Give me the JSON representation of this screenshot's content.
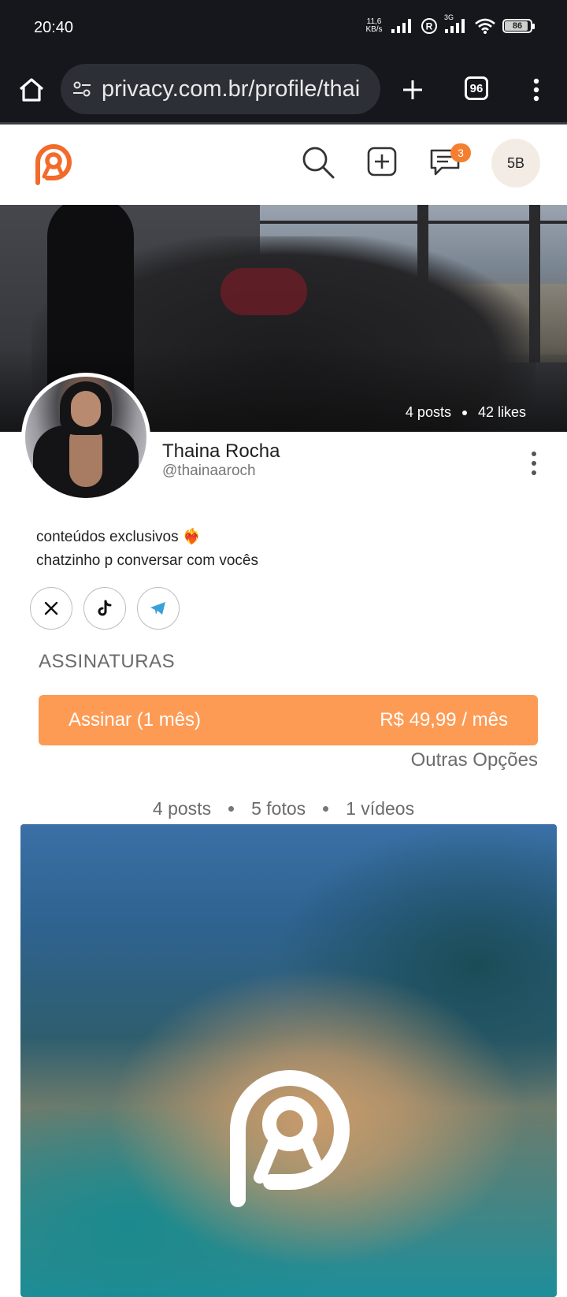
{
  "status_bar": {
    "time": "20:40",
    "net_speed_top": "11,6",
    "net_speed_bottom": "KB/s",
    "network_label": "3G",
    "battery": "86"
  },
  "browser": {
    "url": "privacy.com.br/profile/thai",
    "tab_count": "96"
  },
  "header": {
    "message_badge": "3",
    "avatar_initials": "5B",
    "brand_color": "#f26b2b"
  },
  "cover": {
    "posts": "4 posts",
    "likes": "42 likes"
  },
  "profile": {
    "name": "Thaina Rocha",
    "handle": "@thainaaroch",
    "bio_line1": "conteúdos exclusivos ❤️‍🔥",
    "bio_line2": "chatzinho p conversar com vocês",
    "socials": [
      "x-icon",
      "tiktok-icon",
      "telegram-icon"
    ]
  },
  "subscriptions": {
    "title": "ASSINATURAS",
    "subscribe_label": "Assinar (1 mês)",
    "subscribe_price": "R$ 49,99 / mês",
    "other_options": "Outras Opções",
    "button_color": "#fd9b55"
  },
  "content": {
    "posts": "4 posts",
    "photos": "5 fotos",
    "videos": "1 vídeos"
  }
}
